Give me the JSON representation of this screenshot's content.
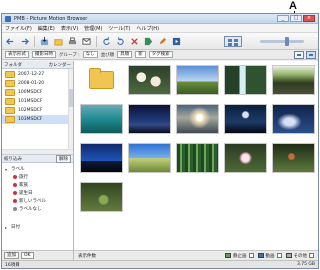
{
  "callout": {
    "letter": "A"
  },
  "window": {
    "title": "PMB - Picture Motion Browser",
    "menu": [
      "ファイル(F)",
      "編集(E)",
      "表示(V)",
      "管理(M)",
      "ツール(T)",
      "ヘルプ(H)"
    ]
  },
  "toolbar2": {
    "view_select": "表示形式",
    "sort_select": "撮影日時",
    "group_label": "グループ :",
    "group_select": "なし",
    "sort_label": "並び順",
    "order_a": "昇順",
    "order_b": "新",
    "filter_select": "タグ検索"
  },
  "left_pane": {
    "view_label": "フォルダ",
    "calendar_label": "カレンダー",
    "folders": [
      "2007-12-27",
      "2008-01-20",
      "100MSDCF",
      "101MSDCF",
      "102MSDCF",
      "103MSDCF"
    ],
    "selected_index": 5,
    "tags_header": "絞り込み",
    "tags_clear": "解除",
    "tag_root": "ラベル",
    "tags": [
      "旅行",
      "家族",
      "誕生日",
      "新しいラベル",
      "ラベルなし"
    ],
    "date_root": "日付",
    "bottom_buttons": [
      "追加",
      "OK"
    ]
  },
  "content": {
    "status_label": "表示件数",
    "filter_items": [
      "静止画",
      "動画",
      "その他"
    ]
  },
  "statusbar": {
    "count": "16項目",
    "size": "3.75 GB"
  },
  "colors": {
    "accent": "#3a6fb5",
    "selection": "#cde0f7",
    "folder": "#f2c451"
  }
}
